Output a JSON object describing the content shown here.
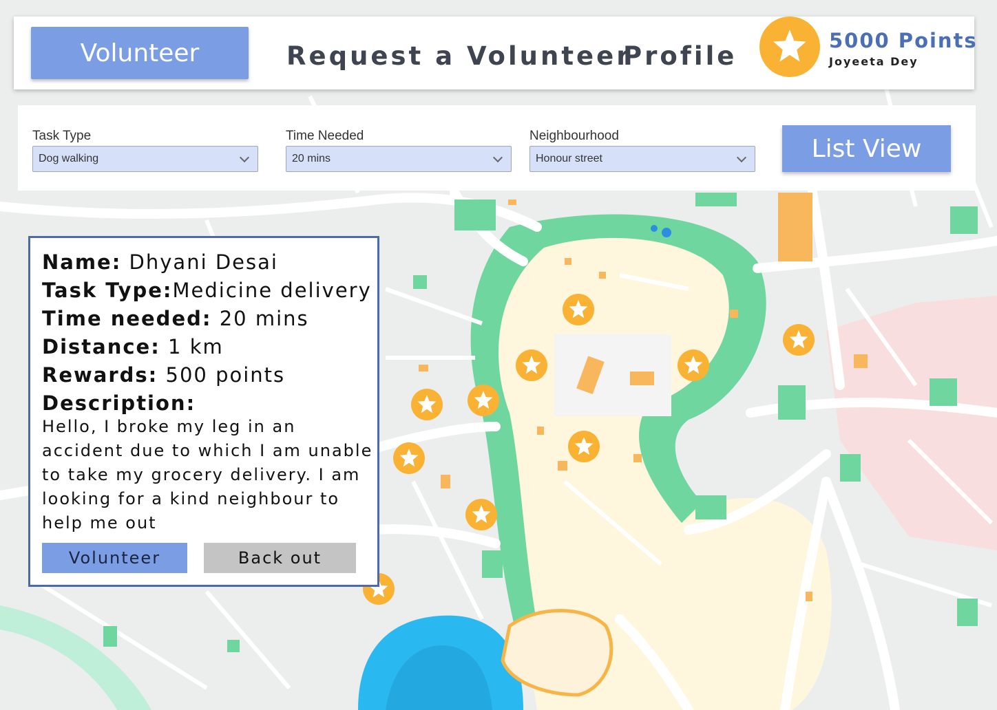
{
  "nav": {
    "volunteer_label": "Volunteer",
    "request_label": "Request a Volunteer",
    "profile_label": "Profile",
    "points": "5000 Points",
    "user_name": "Joyeeta Dey",
    "points_icon": "star-icon"
  },
  "filters": {
    "task_type": {
      "label": "Task Type",
      "value": "Dog walking"
    },
    "time_needed": {
      "label": "Time Needed",
      "value": "20 mins"
    },
    "neighbourhood": {
      "label": "Neighbourhood",
      "value": "Honour street"
    },
    "list_view_label": "List View"
  },
  "card": {
    "name_key": "Name:",
    "name_value": "Dhyani Desai",
    "task_key": "Task Type:",
    "task_value": "Medicine delivery",
    "time_key": "Time needed:",
    "time_value": "20 mins",
    "distance_key": "Distance:",
    "distance_value": "1 km",
    "rewards_key": "Rewards:",
    "rewards_value": "500 points",
    "description_key": "Description:",
    "description_text": "Hello, I broke my leg in an accident due to which I am unable to take my grocery delivery. I am looking for a kind neighbour to help me out",
    "volunteer_label": "Volunteer",
    "back_out_label": "Back out"
  },
  "colors": {
    "accent": "#7b9de3",
    "star": "#f9b233",
    "park": "#6fd6a0",
    "old_town": "#fff6de",
    "water": "#2ab8f0",
    "card_border": "#4c6aa8"
  }
}
